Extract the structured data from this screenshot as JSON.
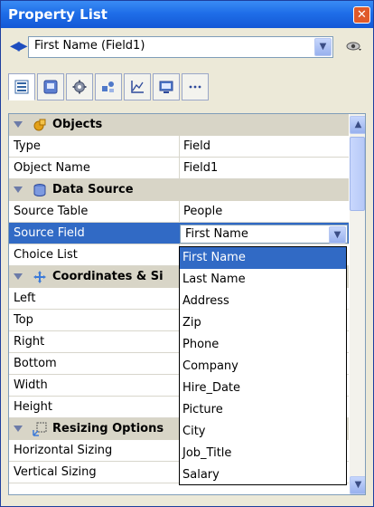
{
  "window": {
    "title": "Property List"
  },
  "object_selector": {
    "value": "First Name (Field1)"
  },
  "tabs": [
    {
      "icon": "list-icon"
    },
    {
      "icon": "display-icon"
    },
    {
      "icon": "gear-icon"
    },
    {
      "icon": "shapes-icon"
    },
    {
      "icon": "chart-icon"
    },
    {
      "icon": "monitor-icon"
    },
    {
      "icon": "more-icon"
    }
  ],
  "grid": {
    "categories": {
      "objects": "Objects",
      "data_source": "Data Source",
      "coordinates": "Coordinates & Si",
      "resizing": "Resizing Options"
    },
    "props": {
      "type": {
        "label": "Type",
        "value": "Field"
      },
      "object_name": {
        "label": "Object Name",
        "value": "Field1"
      },
      "source_table": {
        "label": "Source Table",
        "value": "People"
      },
      "source_field": {
        "label": "Source Field",
        "value": "First Name"
      },
      "choice_list": {
        "label": "Choice List"
      },
      "left": {
        "label": "Left"
      },
      "top": {
        "label": "Top"
      },
      "right": {
        "label": "Right"
      },
      "bottom": {
        "label": "Bottom"
      },
      "width": {
        "label": "Width"
      },
      "height": {
        "label": "Height"
      },
      "horizontal_sizing": {
        "label": "Horizontal Sizing"
      },
      "vertical_sizing": {
        "label": "Vertical Sizing"
      }
    }
  },
  "dropdown": {
    "items": [
      "First Name",
      "Last Name",
      "Address",
      "Zip",
      "Phone",
      "Company",
      "Hire_Date",
      "Picture",
      "City",
      "Job_Title",
      "Salary"
    ],
    "highlighted": "First Name"
  },
  "colors": {
    "titlebar": "#1f6ee8",
    "selection": "#316ac5",
    "category_band": "#d8d5c7"
  }
}
